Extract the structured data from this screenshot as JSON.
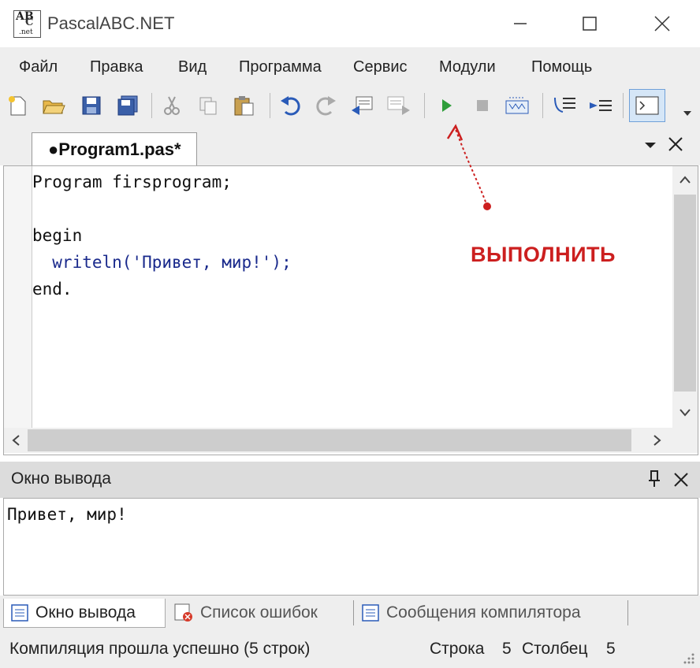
{
  "window": {
    "title": "PascalABC.NET",
    "icon_text": [
      "AB",
      "C",
      ".net"
    ]
  },
  "menu": [
    "Файл",
    "Правка",
    "Вид",
    "Программа",
    "Сервис",
    "Модули",
    "Помощь"
  ],
  "toolbar": {
    "buttons": [
      "new-icon",
      "open-icon",
      "save-icon",
      "save-all-icon",
      "cut-icon",
      "copy-icon",
      "paste-icon",
      "undo-icon",
      "redo-icon",
      "indent-left-icon",
      "indent-right-icon",
      "run-icon",
      "stop-icon",
      "debug-icon",
      "step-into-icon",
      "step-over-icon",
      "console-icon"
    ]
  },
  "editor": {
    "tab_label": "●Program1.pas*",
    "lines": [
      "Program firsprogram;",
      "",
      "begin",
      "  writeln('Привет, мир!');",
      "end."
    ]
  },
  "annotation": {
    "text": "ВЫПОЛНИТЬ",
    "color": "#cc1f1f"
  },
  "output": {
    "title": "Окно вывода",
    "text": "Привет, мир!"
  },
  "bottom_tabs": [
    "Окно вывода",
    "Список ошибок",
    "Сообщения компилятора"
  ],
  "status": {
    "message": "Компиляция прошла успешно (5 строк)",
    "line_label": "Строка",
    "line_value": "5",
    "col_label": "Столбец",
    "col_value": "5"
  }
}
